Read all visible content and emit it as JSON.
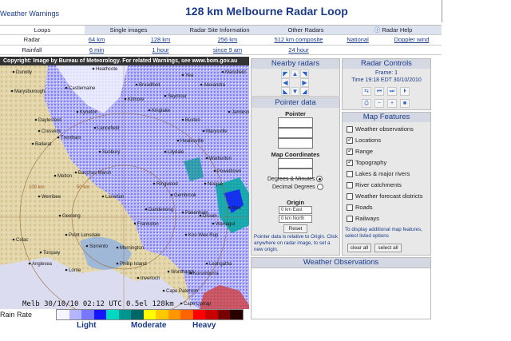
{
  "header": {
    "warnings_link": "Weather Warnings",
    "title": "128 km Melbourne Radar Loop"
  },
  "nav": {
    "tabs": [
      {
        "label": "Loops",
        "active": true
      },
      {
        "label": "Single images",
        "active": false
      },
      {
        "label": "Radar Site Information",
        "active": false
      },
      {
        "label": "Other Radars",
        "active": false
      },
      {
        "label": "Radar Help",
        "active": false
      }
    ],
    "rows": [
      {
        "label": "Radar",
        "links": [
          "64 km",
          "128 km",
          "256 km",
          "512 km composite",
          "National",
          "Doppler wind"
        ]
      },
      {
        "label": "Rainfall",
        "links": [
          "6 min",
          "1 hour",
          "since 9 am",
          "24 hour",
          "",
          ""
        ]
      }
    ]
  },
  "copyright": "Copyright: Image by Bureau of Meteorology. For related Warnings, see www.bom.gov.au",
  "radar": {
    "caption": "Melb    30/10/10 02:12 UTC 0.5el 128km",
    "places": [
      "Dunolly",
      "Heathcote",
      "Yea",
      "Alexandra",
      "Marysburough",
      "Castlemaine",
      "Kyneton",
      "Seymour",
      "Kinglake",
      "Wonthaggi",
      "Geelong",
      "Frankston",
      "Dandenong",
      "Warburton",
      "Lorne",
      "Colac",
      "Ballarat",
      "Bacchus Marsh",
      "Melton",
      "Sunbury",
      "Cape Paterson",
      "Cape Liptrap",
      "Korumburra",
      "Leongatha",
      "Inverloch",
      "Point Lonsdale",
      "Sorrento",
      "Phillip Island",
      "Healesville",
      "Lilydale",
      "Werribee",
      "Laverton",
      "Ringwood",
      "Mornington",
      "Torquay",
      "Anglesea",
      "Daylesford",
      "Creswick",
      "Trentham",
      "Lancefield",
      "Kilmore",
      "Broadford",
      "Mansfield",
      "Warragul",
      "Drouin",
      "Moe",
      "Noojee",
      "Jamieson",
      "Buxton",
      "Marysville",
      "Powelltown",
      "Gembrook",
      "Pakenham",
      "Koo Wee Rup"
    ],
    "range_labels": [
      "100 km",
      "50 km"
    ]
  },
  "rain_rate": {
    "label": "Rain Rate",
    "colors": [
      "#f5f5ff",
      "#b4b4ff",
      "#7878ff",
      "#1414ff",
      "#00d8c3",
      "#009690",
      "#006666",
      "#ffff00",
      "#ffc800",
      "#ff9600",
      "#ff6400",
      "#ff0000",
      "#c80000",
      "#780000",
      "#280000"
    ],
    "light": "Light",
    "moderate": "Moderate",
    "heavy": "Heavy"
  },
  "nearby": {
    "title": "Nearby radars",
    "arrows": [
      "▲",
      "▼",
      "◀",
      "▶",
      "◤",
      "◥",
      "◣",
      "◢"
    ]
  },
  "pointer_data": {
    "title": "Pointer data",
    "pointer_label": "Pointer",
    "coords_label": "Map Coordinates",
    "dm_label": "Degrees & Minutes",
    "dd_label": "Decimal Degrees",
    "origin_label": "Origin",
    "east": "0 km East",
    "north": "0 km North",
    "reset": "Reset",
    "note": "Pointer data is relative to Origin. Click anywhere on radar image, to set a new origin."
  },
  "controls": {
    "title": "Radar Controls",
    "frame": "Frame: 1",
    "time": "Time 19:18 EDT 30/10/2010",
    "icons_top": [
      "⇆",
      "⏮",
      "⏭",
      "⏵"
    ],
    "icons_bottom": [
      "⎙",
      "−",
      "+",
      "■"
    ]
  },
  "features": {
    "title": "Map Features",
    "items": [
      {
        "label": "Weather observations",
        "checked": false
      },
      {
        "label": "Locations",
        "checked": true
      },
      {
        "label": "Range",
        "checked": true
      },
      {
        "label": "Topography",
        "checked": true
      },
      {
        "label": "Lakes & major rivers",
        "checked": false
      },
      {
        "label": "River catchments",
        "checked": false
      },
      {
        "label": "Weather forecast districts",
        "checked": false
      },
      {
        "label": "Roads",
        "checked": false
      },
      {
        "label": "Railways",
        "checked": false
      }
    ],
    "note": "To display additional map features, select listed options",
    "clear_all": "clear all",
    "select_all": "select all"
  },
  "observations": {
    "title": "Weather Observations"
  }
}
